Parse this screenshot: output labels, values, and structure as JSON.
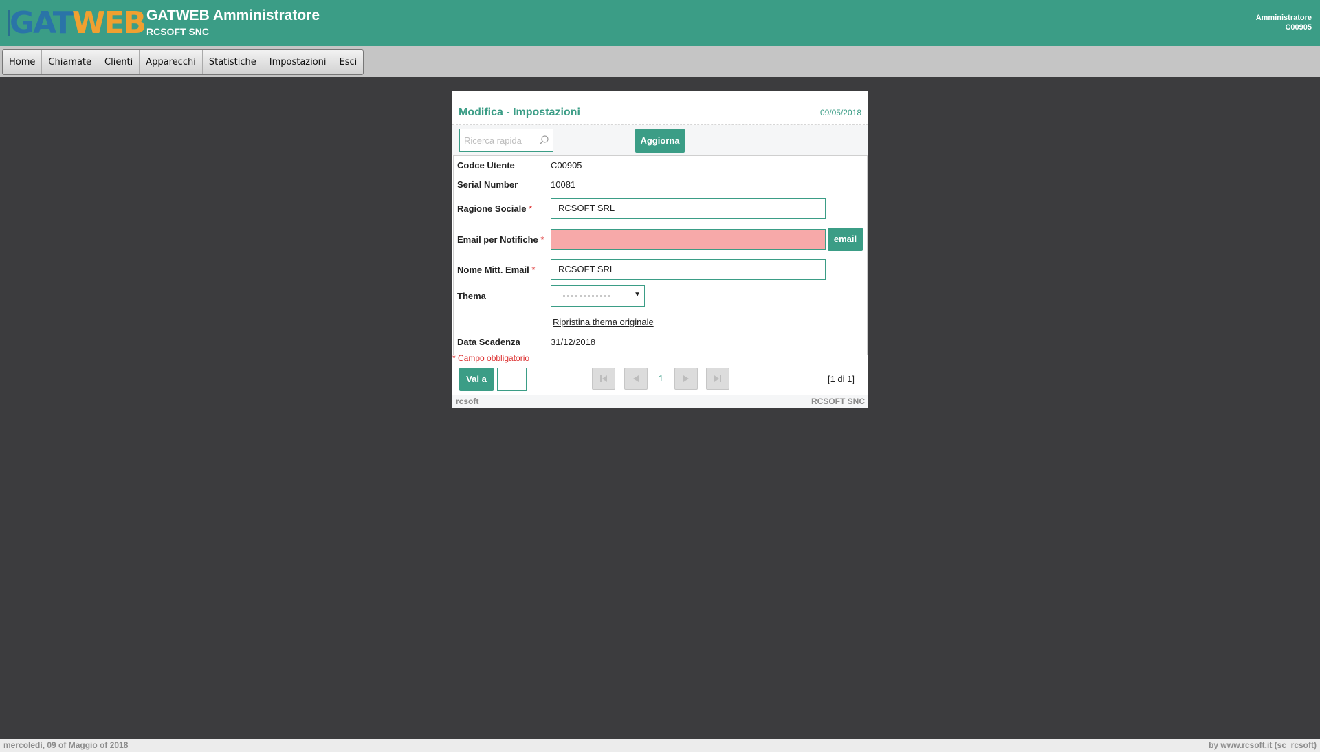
{
  "header": {
    "logo_part1": "GAT",
    "logo_part2": "WEB",
    "app_title": "GATWEB Amministratore",
    "company": "RCSOFT SNC",
    "user_role": "Amministratore",
    "user_code": "C00905"
  },
  "nav": {
    "items": [
      {
        "label": "Home"
      },
      {
        "label": "Chiamate"
      },
      {
        "label": "Clienti"
      },
      {
        "label": "Apparecchi"
      },
      {
        "label": "Statistiche"
      },
      {
        "label": "Impostazioni"
      },
      {
        "label": "Esci"
      }
    ]
  },
  "panel": {
    "title": "Modifica - Impostazioni",
    "date": "09/05/2018",
    "search_placeholder": "Ricerca rapida",
    "refresh_label": "Aggiorna",
    "fields": {
      "codice_label": "Codce Utente",
      "codice_value": "C00905",
      "serial_label": "Serial Number",
      "serial_value": "10081",
      "ragione_label": "Ragione Sociale",
      "ragione_value": "RCSOFT SRL",
      "email_label": "Email per Notifiche",
      "email_value": "",
      "email_button": "email",
      "mitt_label": "Nome Mitt. Email",
      "mitt_value": "RCSOFT SRL",
      "thema_label": "Thema",
      "reset_theme": "Ripristina thema originale",
      "scadenza_label": "Data Scadenza",
      "scadenza_value": "31/12/2018"
    },
    "required_marker": "*",
    "required_note": "* Campo obbligatorio",
    "goto_label": "Vai a",
    "current_page": "1",
    "page_info": "[1 di 1]",
    "footer_left": "rcsoft",
    "footer_right": "RCSOFT SNC"
  },
  "footer": {
    "date_text": "mercoledì, 09 of Maggio of 2018",
    "credit": "by www.rcsoft.it (sc_rcsoft)"
  },
  "colors": {
    "accent": "#3b9d86",
    "background": "#3c3c3e",
    "error_field": "#f7a9a9",
    "required": "#dd3333"
  },
  "icons": [
    "search-icon",
    "first-page-icon",
    "prev-page-icon",
    "next-page-icon",
    "last-page-icon",
    "chevron-down-icon"
  ]
}
